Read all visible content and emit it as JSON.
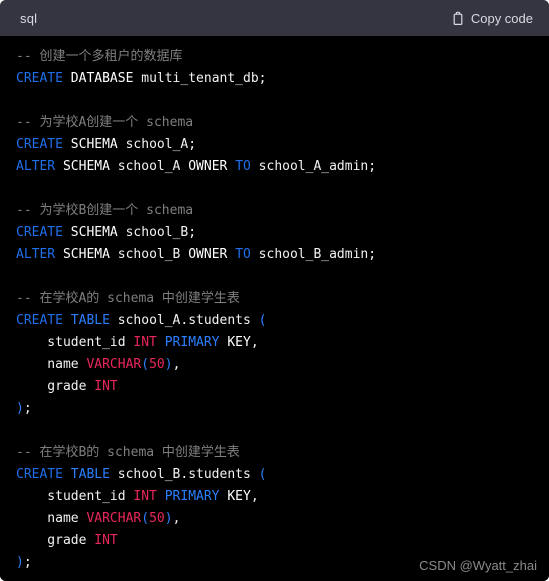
{
  "header": {
    "language_label": "sql",
    "copy_label": "Copy code",
    "copy_icon": "clipboard-icon",
    "background_color": "#343541",
    "text_color": "#d9d9e3"
  },
  "theme": {
    "code_background": "#000000",
    "comment_color": "#7f7f7f",
    "keyword_color": "#1f6feb",
    "keyword_alt_color": "#2b7fff",
    "type_color": "#e8275a",
    "number_color": "#e8275a",
    "plain_color": "#f2f2f2"
  },
  "watermark": {
    "text": "CSDN @Wyatt_zhai",
    "color": "#8a8a8a"
  },
  "code": {
    "language": "sql",
    "lines": [
      [
        {
          "t": "-- 创建一个多租户的数据库",
          "c": "t-com"
        }
      ],
      [
        {
          "t": "CREATE",
          "c": "t-kw"
        },
        {
          "t": " ",
          "c": "t-pln"
        },
        {
          "t": "DATABASE",
          "c": "t-wkw"
        },
        {
          "t": " multi_tenant_db;",
          "c": "t-pln"
        }
      ],
      [],
      [
        {
          "t": "-- 为学校A创建一个 schema",
          "c": "t-com"
        }
      ],
      [
        {
          "t": "CREATE",
          "c": "t-kw"
        },
        {
          "t": " ",
          "c": "t-pln"
        },
        {
          "t": "SCHEMA",
          "c": "t-wkw"
        },
        {
          "t": " school_A;",
          "c": "t-pln"
        }
      ],
      [
        {
          "t": "ALTER",
          "c": "t-kw"
        },
        {
          "t": " ",
          "c": "t-pln"
        },
        {
          "t": "SCHEMA",
          "c": "t-wkw"
        },
        {
          "t": " school_A ",
          "c": "t-pln"
        },
        {
          "t": "OWNER",
          "c": "t-wkw"
        },
        {
          "t": " ",
          "c": "t-pln"
        },
        {
          "t": "TO",
          "c": "t-kw"
        },
        {
          "t": " school_A_admin;",
          "c": "t-pln"
        }
      ],
      [],
      [
        {
          "t": "-- 为学校B创建一个 schema",
          "c": "t-com"
        }
      ],
      [
        {
          "t": "CREATE",
          "c": "t-kw"
        },
        {
          "t": " ",
          "c": "t-pln"
        },
        {
          "t": "SCHEMA",
          "c": "t-wkw"
        },
        {
          "t": " school_B;",
          "c": "t-pln"
        }
      ],
      [
        {
          "t": "ALTER",
          "c": "t-kw"
        },
        {
          "t": " ",
          "c": "t-pln"
        },
        {
          "t": "SCHEMA",
          "c": "t-wkw"
        },
        {
          "t": " school_B ",
          "c": "t-pln"
        },
        {
          "t": "OWNER",
          "c": "t-wkw"
        },
        {
          "t": " ",
          "c": "t-pln"
        },
        {
          "t": "TO",
          "c": "t-kw"
        },
        {
          "t": " school_B_admin;",
          "c": "t-pln"
        }
      ],
      [],
      [
        {
          "t": "-- 在学校A的 schema 中创建学生表",
          "c": "t-com"
        }
      ],
      [
        {
          "t": "CREATE",
          "c": "t-kw"
        },
        {
          "t": " ",
          "c": "t-pln"
        },
        {
          "t": "TABLE",
          "c": "t-kw2"
        },
        {
          "t": " school_A.students ",
          "c": "t-pln"
        },
        {
          "t": "(",
          "c": "t-pun"
        }
      ],
      [
        {
          "t": "    student_id ",
          "c": "t-pln"
        },
        {
          "t": "INT",
          "c": "t-typ"
        },
        {
          "t": " ",
          "c": "t-pln"
        },
        {
          "t": "PRIMARY",
          "c": "t-kw2"
        },
        {
          "t": " ",
          "c": "t-pln"
        },
        {
          "t": "KEY",
          "c": "t-wkw"
        },
        {
          "t": ",",
          "c": "t-pln"
        }
      ],
      [
        {
          "t": "    name ",
          "c": "t-pln"
        },
        {
          "t": "VARCHAR",
          "c": "t-typ"
        },
        {
          "t": "(",
          "c": "t-pun"
        },
        {
          "t": "50",
          "c": "t-num"
        },
        {
          "t": ")",
          "c": "t-pun"
        },
        {
          "t": ",",
          "c": "t-pln"
        }
      ],
      [
        {
          "t": "    grade ",
          "c": "t-pln"
        },
        {
          "t": "INT",
          "c": "t-typ"
        }
      ],
      [
        {
          "t": ")",
          "c": "t-pun"
        },
        {
          "t": ";",
          "c": "t-pln"
        }
      ],
      [],
      [
        {
          "t": "-- 在学校B的 schema 中创建学生表",
          "c": "t-com"
        }
      ],
      [
        {
          "t": "CREATE",
          "c": "t-kw"
        },
        {
          "t": " ",
          "c": "t-pln"
        },
        {
          "t": "TABLE",
          "c": "t-kw2"
        },
        {
          "t": " school_B.students ",
          "c": "t-pln"
        },
        {
          "t": "(",
          "c": "t-pun"
        }
      ],
      [
        {
          "t": "    student_id ",
          "c": "t-pln"
        },
        {
          "t": "INT",
          "c": "t-typ"
        },
        {
          "t": " ",
          "c": "t-pln"
        },
        {
          "t": "PRIMARY",
          "c": "t-kw2"
        },
        {
          "t": " ",
          "c": "t-pln"
        },
        {
          "t": "KEY",
          "c": "t-wkw"
        },
        {
          "t": ",",
          "c": "t-pln"
        }
      ],
      [
        {
          "t": "    name ",
          "c": "t-pln"
        },
        {
          "t": "VARCHAR",
          "c": "t-typ"
        },
        {
          "t": "(",
          "c": "t-pun"
        },
        {
          "t": "50",
          "c": "t-num"
        },
        {
          "t": ")",
          "c": "t-pun"
        },
        {
          "t": ",",
          "c": "t-pln"
        }
      ],
      [
        {
          "t": "    grade ",
          "c": "t-pln"
        },
        {
          "t": "INT",
          "c": "t-typ"
        }
      ],
      [
        {
          "t": ")",
          "c": "t-pun"
        },
        {
          "t": ";",
          "c": "t-pln"
        }
      ]
    ]
  }
}
